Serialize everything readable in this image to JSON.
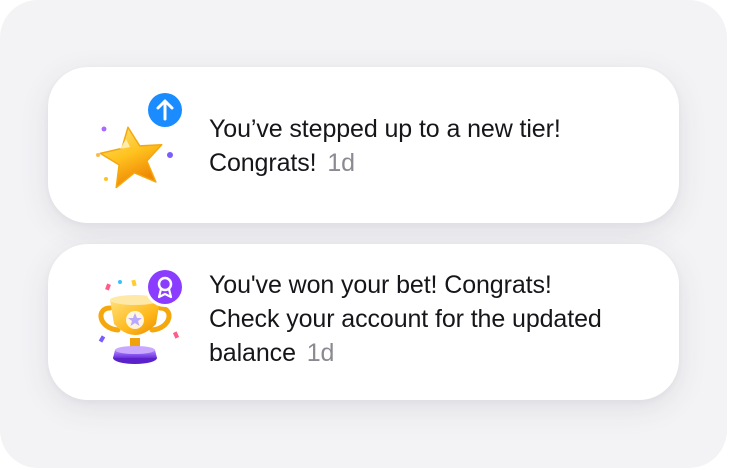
{
  "notifications": [
    {
      "icon": "star-icon",
      "badge_icon": "arrow-up-icon",
      "badge_color": "#1a8cff",
      "line1": "You’ve stepped up to a new tier!",
      "line2": "Congrats!",
      "time": "1d"
    },
    {
      "icon": "trophy-icon",
      "badge_icon": "medal-icon",
      "badge_color": "#8b3dff",
      "line1": "You've won your bet! Congrats!",
      "line2": "Check your account for the updated",
      "line3": "balance",
      "time": "1d"
    }
  ]
}
